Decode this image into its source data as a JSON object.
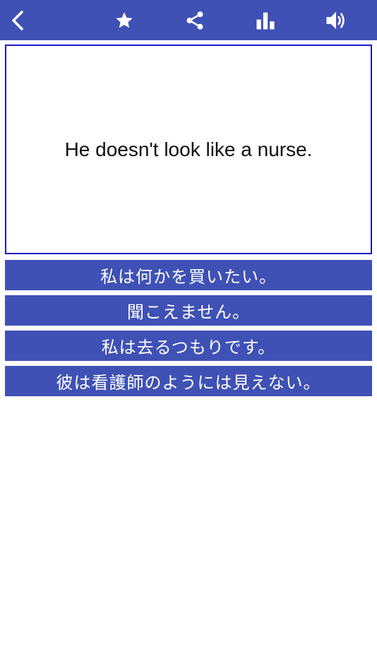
{
  "toolbar": {
    "accent": "#3f51b5",
    "icons": [
      "back-icon",
      "star-icon",
      "share-icon",
      "stats-icon",
      "sound-icon"
    ]
  },
  "card": {
    "text": "He doesn't look like a nurse."
  },
  "answers": [
    "私は何かを買いたい。",
    "聞こえません。",
    "私は去るつもりです。",
    "彼は看護師のようには見えない。"
  ]
}
